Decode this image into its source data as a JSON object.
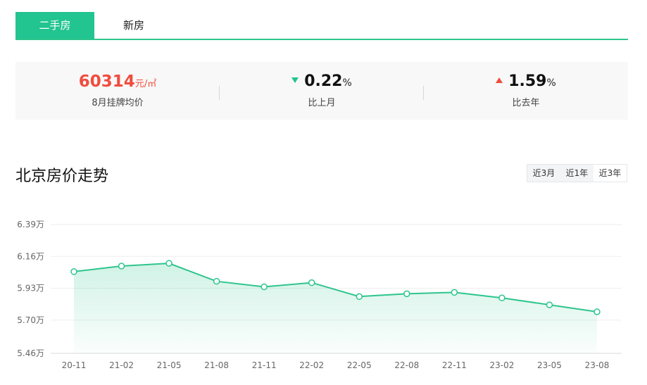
{
  "tabs": [
    {
      "label": "二手房",
      "active": true
    },
    {
      "label": "新房",
      "active": false
    }
  ],
  "stats": {
    "price": {
      "value": "60314",
      "unit": "元/㎡",
      "label": "8月挂牌均价"
    },
    "mom": {
      "direction": "down",
      "value": "0.22",
      "unit": "%",
      "label": "比上月"
    },
    "yoy": {
      "direction": "up",
      "value": "1.59",
      "unit": "%",
      "label": "比去年"
    }
  },
  "title": "北京房价走势",
  "range_buttons": [
    {
      "label": "近3月",
      "selected": false
    },
    {
      "label": "近1年",
      "selected": false
    },
    {
      "label": "近3年",
      "selected": true
    }
  ],
  "colors": {
    "accent": "#22c48f",
    "up": "#f04c3d",
    "line": "#2ec58e"
  },
  "chart_data": {
    "type": "area",
    "title": "",
    "xlabel": "",
    "ylabel": "",
    "x": [
      "20-11",
      "21-02",
      "21-05",
      "21-08",
      "21-11",
      "22-02",
      "22-05",
      "22-08",
      "22-11",
      "23-02",
      "23-05",
      "23-08"
    ],
    "series": [
      {
        "values": [
          6.05,
          6.09,
          6.11,
          5.98,
          5.94,
          5.97,
          5.87,
          5.89,
          5.9,
          5.86,
          5.81,
          5.76
        ]
      }
    ],
    "yticks": [
      "5.46万",
      "5.70万",
      "5.93万",
      "6.16万",
      "6.39万"
    ],
    "ytick_values": [
      5.46,
      5.7,
      5.93,
      6.16,
      6.39
    ],
    "ylim": [
      5.46,
      6.39
    ],
    "grid": true,
    "legend": "none"
  }
}
